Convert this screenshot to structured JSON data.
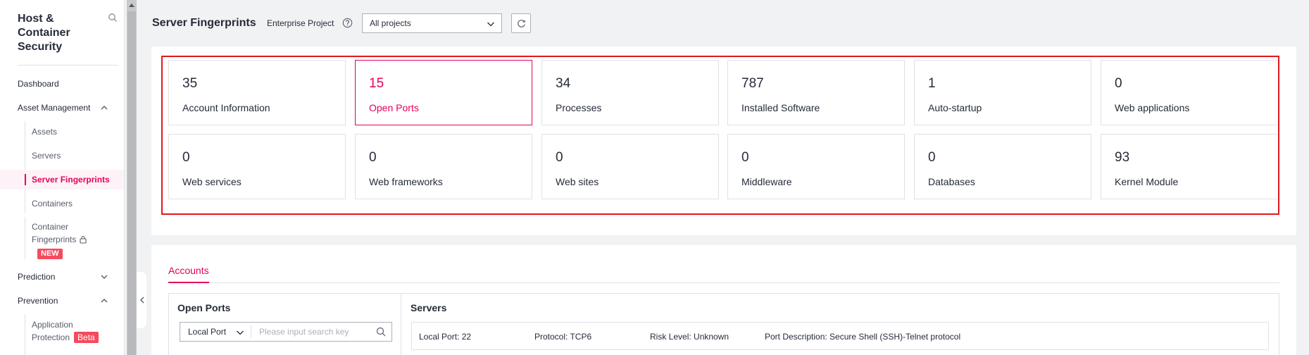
{
  "sidebar": {
    "title": "Host & Container Security",
    "items": {
      "dashboard": "Dashboard",
      "asset_management": "Asset Management",
      "assets": "Assets",
      "servers": "Servers",
      "server_fingerprints": "Server Fingerprints",
      "containers": "Containers",
      "container_fingerprints_line1": "Container",
      "container_fingerprints_line2": "Fingerprints",
      "new_badge": "NEW",
      "prediction": "Prediction",
      "prevention": "Prevention",
      "app_protection_line1": "Application",
      "app_protection_line2": "Protection",
      "beta_badge": "Beta"
    }
  },
  "header": {
    "title": "Server Fingerprints",
    "enterprise_project_label": "Enterprise Project",
    "project_select_value": "All projects"
  },
  "stats": [
    {
      "value": "35",
      "label": "Account Information",
      "active": false
    },
    {
      "value": "15",
      "label": "Open Ports",
      "active": true
    },
    {
      "value": "34",
      "label": "Processes",
      "active": false
    },
    {
      "value": "787",
      "label": "Installed Software",
      "active": false
    },
    {
      "value": "1",
      "label": "Auto-startup",
      "active": false
    },
    {
      "value": "0",
      "label": "Web applications",
      "active": false
    },
    {
      "value": "0",
      "label": "Web services",
      "active": false
    },
    {
      "value": "0",
      "label": "Web frameworks",
      "active": false
    },
    {
      "value": "0",
      "label": "Web sites",
      "active": false
    },
    {
      "value": "0",
      "label": "Middleware",
      "active": false
    },
    {
      "value": "0",
      "label": "Databases",
      "active": false
    },
    {
      "value": "93",
      "label": "Kernel Module",
      "active": false
    }
  ],
  "detail": {
    "tab": "Accounts",
    "left_title": "Open Ports",
    "filter_select": "Local Port",
    "filter_placeholder": "Please input search key",
    "right_title": "Servers",
    "row": {
      "local_port": "Local Port: 22",
      "protocol": "Protocol: TCP6",
      "risk_level": "Risk Level: Unknown",
      "port_description": "Port Description: Secure Shell (SSH)-Telnet protocol"
    }
  },
  "colors": {
    "accent": "#e5005a",
    "highlight_border": "#e0191e",
    "badge": "#f64a5e"
  }
}
